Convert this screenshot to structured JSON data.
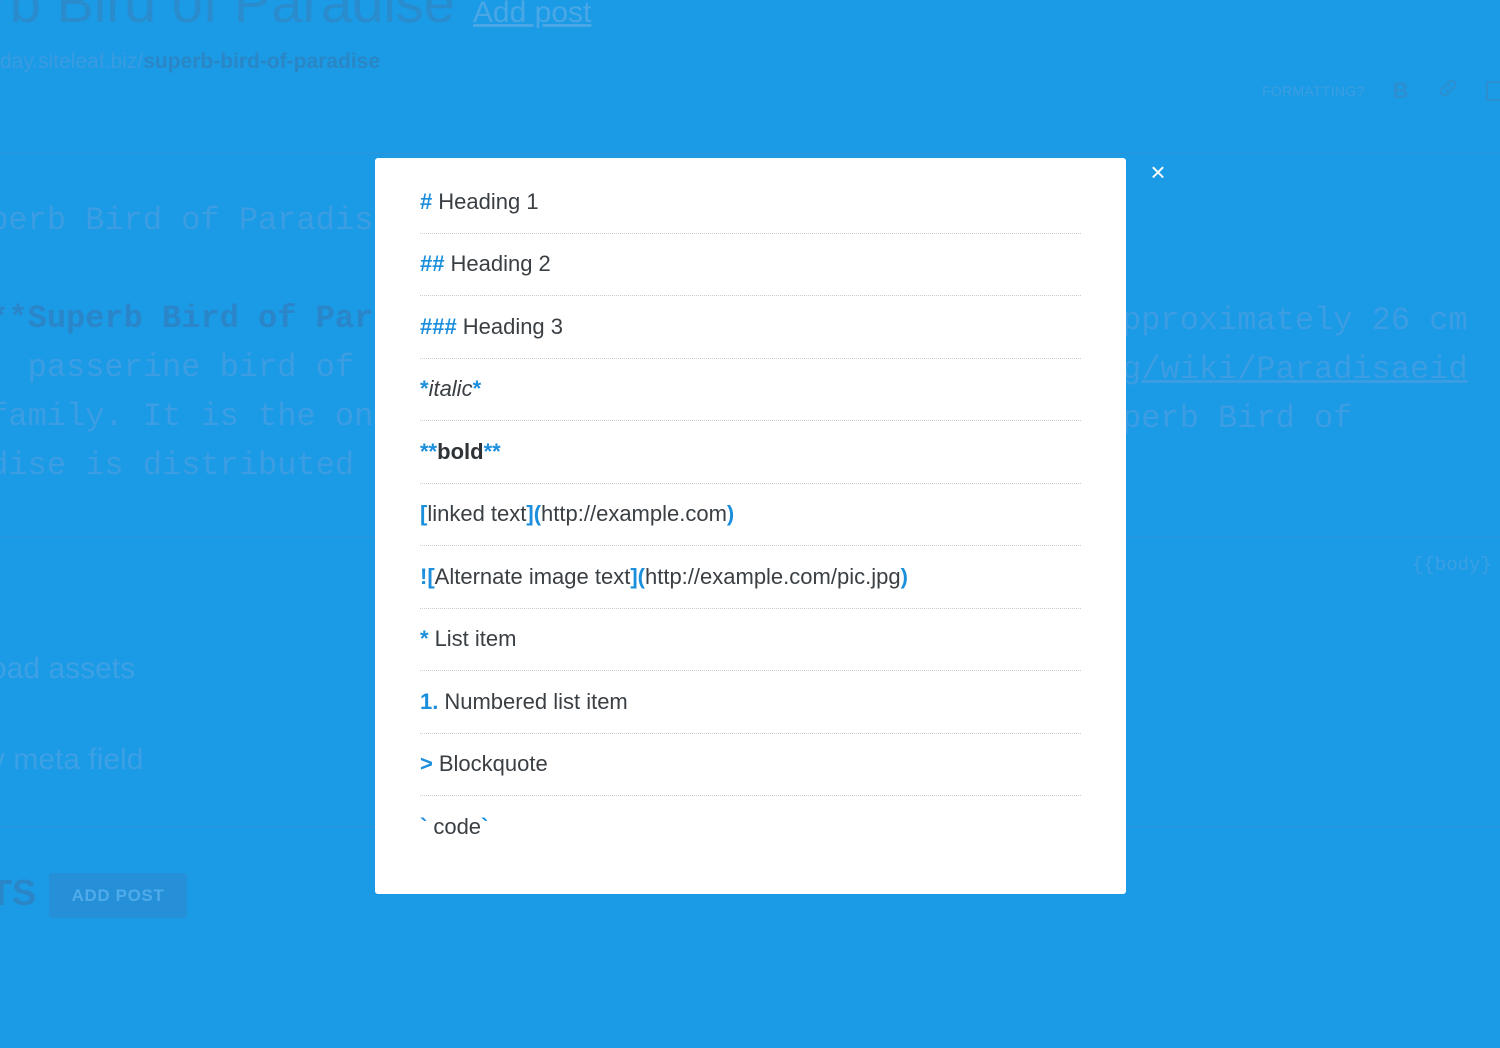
{
  "background": {
    "title": "erb Bird of Paradise",
    "add_post_link": "Add post",
    "url_prefix": "day.siteleaf.biz/",
    "url_slug": "superb-bird-of-paradise",
    "toolbar": {
      "formatting_label": "FORMATTING?",
      "bold_icon": "B"
    },
    "editor_lines": {
      "line1": "uperb Bird of Paradis",
      "line2_prefix": " ",
      "line2_strong": "**Superb Bird of Par",
      "line3": "g, passerine bird of",
      "line4": " family. It is the on",
      "line5": "adise is distributed "
    },
    "right_lines": {
      "line1": "pproximately 26 cm",
      "line2": "g/wiki/Paradisaeid",
      "line3": "perb Bird of"
    },
    "body_tag": "{{body}",
    "upload_assets": "oad assets",
    "meta_field": "v meta field",
    "section_title": "TS",
    "add_post_button": "ADD POST"
  },
  "modal": {
    "close_symbol": "×",
    "rows": {
      "h1": {
        "mark": "#",
        "text": "Heading 1"
      },
      "h2": {
        "mark": "##",
        "text": "Heading 2"
      },
      "h3": {
        "mark": "###",
        "text": "Heading 3"
      },
      "italic": {
        "mark": "*",
        "text": "italic"
      },
      "bold": {
        "mark": "**",
        "text": "bold"
      },
      "link": {
        "open": "[",
        "text": "linked text",
        "mid": "](",
        "url": "http://example.com",
        "close": ")"
      },
      "image": {
        "open": "![",
        "text": "Alternate image text",
        "mid": "](",
        "url": "http://example.com/pic.jpg",
        "close": ")"
      },
      "list": {
        "mark": "*",
        "text": "List item"
      },
      "numbered": {
        "mark": "1.",
        "text": "Numbered list item"
      },
      "quote": {
        "mark": ">",
        "text": "Blockquote"
      },
      "code": {
        "mark": "`",
        "text": "code"
      }
    }
  }
}
